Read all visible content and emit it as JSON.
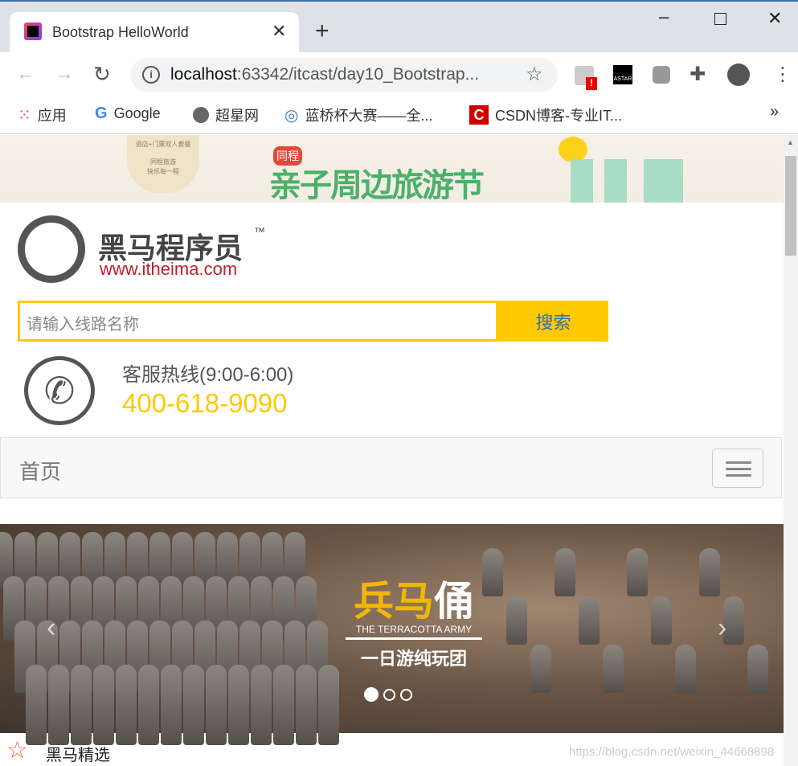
{
  "browser": {
    "tab_title": "Bootstrap HelloWorld",
    "url_host": "localhost",
    "url_rest": ":63342/itcast/day10_Bootstrap...",
    "bookmarks": [
      {
        "label": "应用",
        "icon": "apps-grid-icon"
      },
      {
        "label": "Google",
        "icon": "google-icon"
      },
      {
        "label": "超星网",
        "icon": "globe-icon"
      },
      {
        "label": "蓝桥杯大赛——全...",
        "icon": "lanqiao-icon"
      },
      {
        "label": "CSDN博客-专业IT...",
        "icon": "csdn-icon"
      }
    ],
    "more": "»"
  },
  "banner": {
    "badge": "同程",
    "title": "亲子周边旅游节",
    "note1": "酒店+门票双人套餐",
    "note2": "同程旅游",
    "note3": "快乐每一程"
  },
  "logo": {
    "name": "黑马程序员",
    "tm": "™",
    "site": "www.itheima.com"
  },
  "search": {
    "placeholder": "请输入线路名称",
    "button": "搜索"
  },
  "hotline": {
    "label": "客服热线(9:00-6:00)",
    "number": "400-618-9090"
  },
  "navbar": {
    "brand": "首页"
  },
  "carousel": {
    "title_a": "兵马",
    "title_b": "俑",
    "subtitle": "THE TERRACOTTA ARMY",
    "tagline": "一日游纯玩团",
    "slides": 3,
    "active": 1
  },
  "section": {
    "title": "黑马精选"
  },
  "watermark": "https://blog.csdn.net/weixin_44668898",
  "colors": {
    "accent": "#ffc900",
    "link": "#2a6fb8"
  }
}
